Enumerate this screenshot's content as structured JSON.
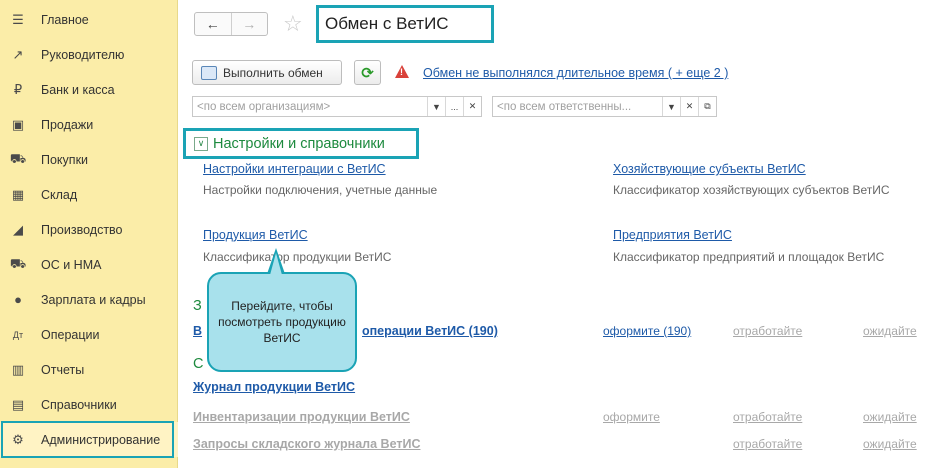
{
  "sidebar": {
    "items": [
      {
        "label": "Главное",
        "icon": "menu-icon"
      },
      {
        "label": "Руководителю",
        "icon": "trend-icon"
      },
      {
        "label": "Банк и касса",
        "icon": "ruble-icon"
      },
      {
        "label": "Продажи",
        "icon": "bag-icon"
      },
      {
        "label": "Покупки",
        "icon": "cart-icon"
      },
      {
        "label": "Склад",
        "icon": "warehouse-icon"
      },
      {
        "label": "Производство",
        "icon": "factory-icon"
      },
      {
        "label": "ОС и НМА",
        "icon": "truck-icon"
      },
      {
        "label": "Зарплата и кадры",
        "icon": "person-icon"
      },
      {
        "label": "Операции",
        "icon": "operations-icon"
      },
      {
        "label": "Отчеты",
        "icon": "report-icon"
      },
      {
        "label": "Справочники",
        "icon": "books-icon"
      },
      {
        "label": "Администрирование",
        "icon": "gear-icon"
      }
    ]
  },
  "header": {
    "title": "Обмен с ВетИС"
  },
  "toolbar": {
    "exec_label": "Выполнить обмен",
    "warning_link": "Обмен не выполнялся длительное время ( + еще 2 )"
  },
  "filters": {
    "org_placeholder": "<по всем организациям>",
    "resp_placeholder": "<по всем ответственны..."
  },
  "section_settings": {
    "title": "Настройки и справочники",
    "links": [
      {
        "label": "Настройки интеграции с ВетИС",
        "desc": "Настройки подключения, учетные данные"
      },
      {
        "label": "Хозяйствующие субъекты ВетИС",
        "desc": "Классификатор хозяйствующих субъектов ВетИС"
      },
      {
        "label": "Продукция ВетИС",
        "desc": "Классификатор продукции ВетИС"
      },
      {
        "label": "Предприятия ВетИС",
        "desc": "Классификатор предприятий и площадок ВетИС"
      }
    ]
  },
  "section_ops": {
    "title_partial": "З",
    "row_label_partial": "В",
    "row_label_tail": "операции ВетИС (190)",
    "actions": [
      "оформите (190)",
      "отработайте",
      "ожидайте"
    ]
  },
  "section_journal": {
    "title_partial": "С",
    "journal_link": "Журнал продукции ВетИС",
    "rows": [
      {
        "label": "Инвентаризации продукции ВетИС",
        "actions": [
          "оформите",
          "отработайте",
          "ожидайте"
        ]
      },
      {
        "label": "Запросы складского журнала ВетИС",
        "actions": [
          "отработайте",
          "ожидайте"
        ]
      }
    ]
  },
  "callout": {
    "text": "Перейдите, чтобы посмотреть продукцию ВетИС"
  },
  "colors": {
    "sidebar_bg": "#fbeda8",
    "highlight": "#1aa3b5",
    "link": "#1e5aa8",
    "section_green": "#1d8a3e",
    "callout_bg": "#a8e1ec"
  }
}
